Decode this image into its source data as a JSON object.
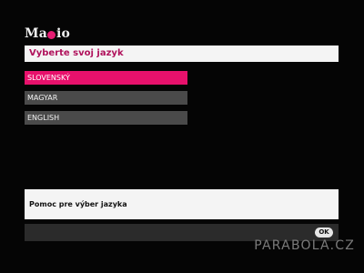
{
  "brand": {
    "logo_left": "Ma",
    "logo_right": "io",
    "accent_color": "#e8116c"
  },
  "header": {
    "title": "Vyberte svoj jazyk"
  },
  "languages": [
    {
      "label": "SLOVENSKÝ",
      "selected": true
    },
    {
      "label": "MAGYAR",
      "selected": false
    },
    {
      "label": "ENGLISH",
      "selected": false
    }
  ],
  "help": {
    "text": "Pomoc pre výber jazyka"
  },
  "footer": {
    "ok_label": "OK"
  },
  "watermark": "PARABOLA.CZ"
}
